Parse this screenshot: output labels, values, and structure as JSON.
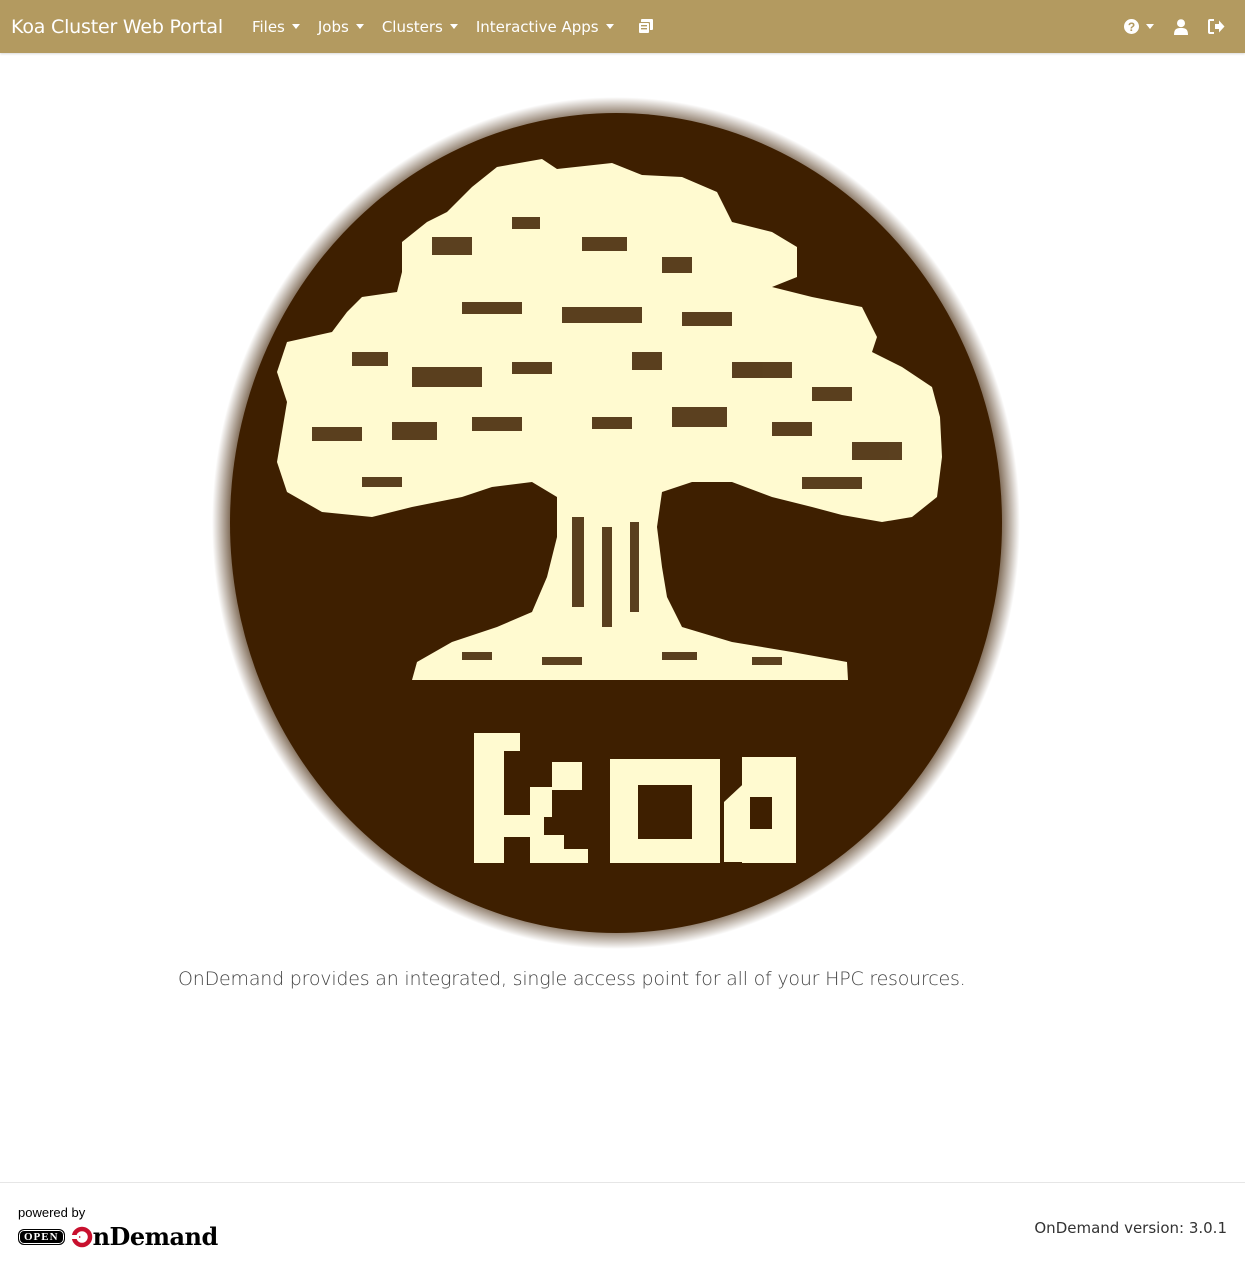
{
  "navbar": {
    "brand": "Koa Cluster Web Portal",
    "menus": [
      {
        "label": "Files"
      },
      {
        "label": "Jobs"
      },
      {
        "label": "Clusters"
      },
      {
        "label": "Interactive Apps"
      }
    ],
    "background_color": "#b39a60",
    "right_icons": [
      "help-icon",
      "user-icon",
      "logout-icon"
    ],
    "sessions_icon": "sessions-icon"
  },
  "logo": {
    "text": "KOA",
    "circle_color": "#3e1f00",
    "tree_color": "#fffad0"
  },
  "tagline": "OnDemand provides an integrated, single access point for all of your HPC resources.",
  "footer": {
    "powered_by": "powered by",
    "open_badge": "OPEN",
    "ondemand_logo_text": "nDemand",
    "version": "OnDemand version: 3.0.1"
  }
}
